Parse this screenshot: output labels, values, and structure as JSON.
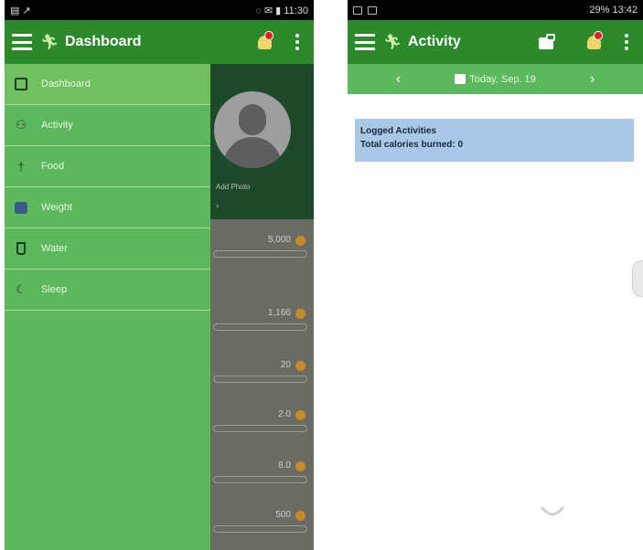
{
  "left_phone": {
    "status": {
      "left": "▤ ↗",
      "right": "◌ ✉ ▮ 11:30"
    },
    "toolbar": {
      "title": "Dashboard",
      "notifications": "0"
    },
    "add_photo": "Add Photo",
    "goal_values": [
      "5,000",
      "1,166",
      "20",
      "2.0",
      "8.0",
      "500"
    ],
    "drawer": {
      "items": [
        {
          "label": "Dashboard",
          "icon": "dashboard-icon"
        },
        {
          "label": "Activity",
          "icon": "activity-icon"
        },
        {
          "label": "Food",
          "icon": "food-icon"
        },
        {
          "label": "Weight",
          "icon": "weight-icon"
        },
        {
          "label": "Water",
          "icon": "water-icon"
        },
        {
          "label": "Sleep",
          "icon": "sleep-icon"
        }
      ]
    }
  },
  "right_phone": {
    "status": {
      "right": "29% 13:42"
    },
    "toolbar": {
      "title": "Activity",
      "notifications": "0"
    },
    "date": {
      "label": "Today, Sep. 19"
    },
    "logged": {
      "title": "Logged Activities",
      "calories": "Total calories burned: 0"
    }
  },
  "colors": {
    "toolbar": "#2c8a2c",
    "drawer": "#5cb85c",
    "panel": "#a9c8e8"
  }
}
